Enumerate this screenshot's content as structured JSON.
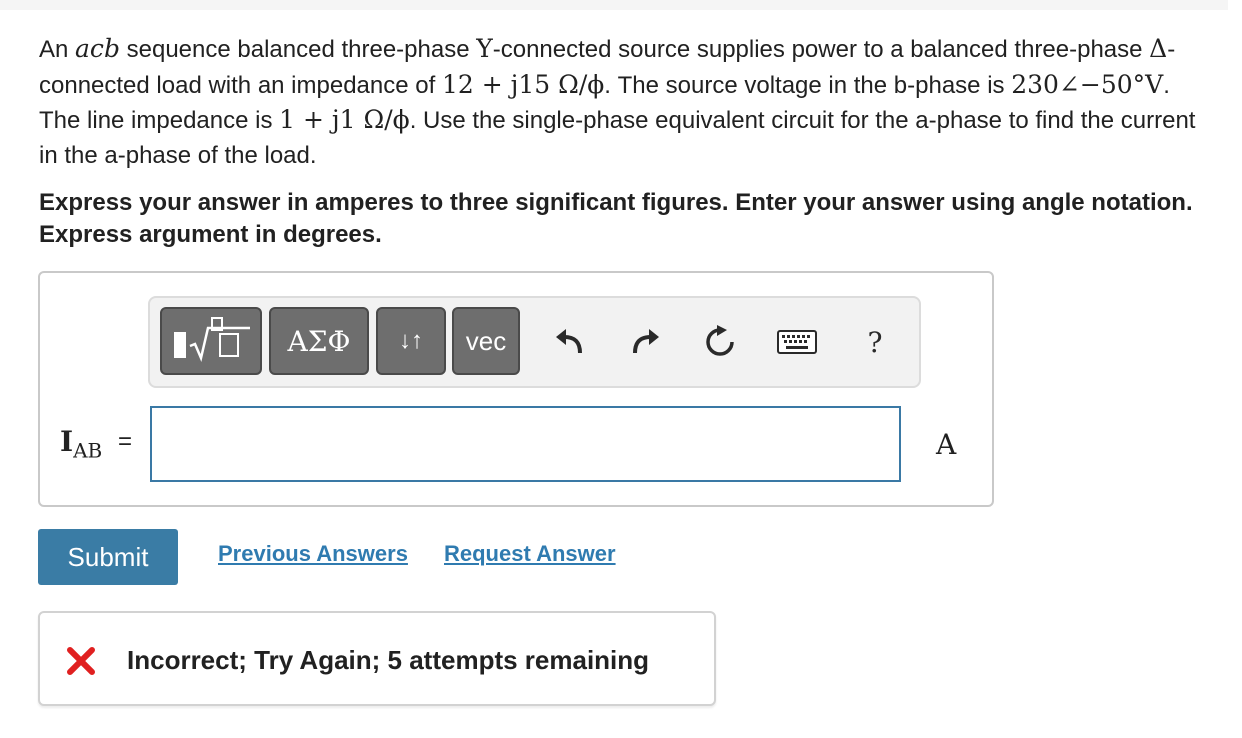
{
  "problem": {
    "s1": "An ",
    "seq": "acb",
    "s2": " sequence balanced three-phase ",
    "y": "Y",
    "s3": "-connected source supplies power to a balanced three-phase ",
    "delta": "Δ",
    "s4": "-connected load with an impedance of ",
    "z_load": "12 + j15 Ω/ϕ",
    "s5": ". The source voltage in the b-phase is ",
    "v_b": "230∠−50°V",
    "s6": ". The line impedance is ",
    "z_line": "1 + j1 Ω/ϕ",
    "s7": ". Use the single-phase equivalent circuit for the a-phase to find the current in the a-phase of the load."
  },
  "instructions": "Express your answer in amperes to three significant figures. Enter your answer using angle notation. Express argument in degrees.",
  "toolbar": {
    "templates_icon": "templates-sqrt-icon",
    "greek_label": "ΑΣΦ",
    "arrows_label": "↓↑",
    "vec_label": "vec",
    "undo_icon": "undo-arrow-icon",
    "redo_icon": "redo-arrow-icon",
    "reset_icon": "reset-icon",
    "keyboard_icon": "keyboard-icon",
    "help_label": "?"
  },
  "answer": {
    "label_main": "I",
    "label_sub": "AB",
    "equals": "=",
    "value": "",
    "unit": "A"
  },
  "actions": {
    "submit_label": "Submit",
    "previous_answers_label": "Previous Answers",
    "request_answer_label": "Request Answer"
  },
  "feedback": {
    "icon": "x-mark-icon",
    "message": "Incorrect; Try Again; 5 attempts remaining"
  },
  "colors": {
    "accent": "#3a7ca5",
    "link": "#2f7bb0",
    "error": "#e02020",
    "toolbar_button": "#6e6e6e"
  }
}
